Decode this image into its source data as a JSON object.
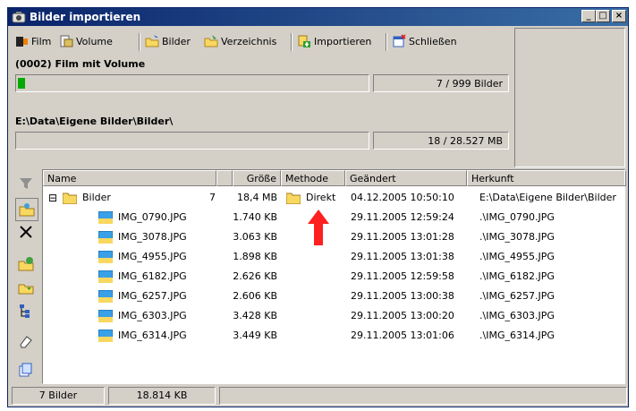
{
  "window": {
    "title": "Bilder importieren"
  },
  "toolbar": {
    "film": "Film",
    "volume": "Volume",
    "bilder": "Bilder",
    "verzeichnis": "Verzeichnis",
    "importieren": "Importieren",
    "schliessen": "Schließen"
  },
  "panel": {
    "film_label": "(0002) Film mit Volume",
    "film_count": "7 / 999 Bilder",
    "film_progress": 0.02,
    "path_label": "E:\\Data\\Eigene Bilder\\Bilder\\",
    "path_count": "18 / 28.527 MB",
    "path_progress": 0
  },
  "list": {
    "headers": {
      "name": "Name",
      "size": "Größe",
      "method": "Methode",
      "changed": "Geändert",
      "origin": "Herkunft"
    },
    "folder": {
      "expander": "⊟",
      "name": "Bilder",
      "count": "7",
      "size": "18,4 MB",
      "method": "Direkt",
      "changed": "04.12.2005 10:50:10",
      "origin": "E:\\Data\\Eigene Bilder\\Bilder"
    },
    "files": [
      {
        "name": "IMG_0790.JPG",
        "size": "1.740 KB",
        "changed": "29.11.2005 12:59:24",
        "origin": ".\\IMG_0790.JPG"
      },
      {
        "name": "IMG_3078.JPG",
        "size": "3.063 KB",
        "changed": "29.11.2005 13:01:28",
        "origin": ".\\IMG_3078.JPG"
      },
      {
        "name": "IMG_4955.JPG",
        "size": "1.898 KB",
        "changed": "29.11.2005 13:01:38",
        "origin": ".\\IMG_4955.JPG"
      },
      {
        "name": "IMG_6182.JPG",
        "size": "2.626 KB",
        "changed": "29.11.2005 12:59:58",
        "origin": ".\\IMG_6182.JPG"
      },
      {
        "name": "IMG_6257.JPG",
        "size": "2.606 KB",
        "changed": "29.11.2005 13:00:38",
        "origin": ".\\IMG_6257.JPG"
      },
      {
        "name": "IMG_6303.JPG",
        "size": "3.428 KB",
        "changed": "29.11.2005 13:00:20",
        "origin": ".\\IMG_6303.JPG"
      },
      {
        "name": "IMG_6314.JPG",
        "size": "3.449 KB",
        "changed": "29.11.2005 13:01:06",
        "origin": ".\\IMG_6314.JPG"
      }
    ]
  },
  "status": {
    "count": "7 Bilder",
    "size": "18.814 KB"
  },
  "window_buttons": {
    "minimize": "_",
    "maximize": "□",
    "close": "×"
  },
  "colors": {
    "titlebar": "#0a246a",
    "progress": "#00aa00",
    "arrow": "#ff2020"
  }
}
